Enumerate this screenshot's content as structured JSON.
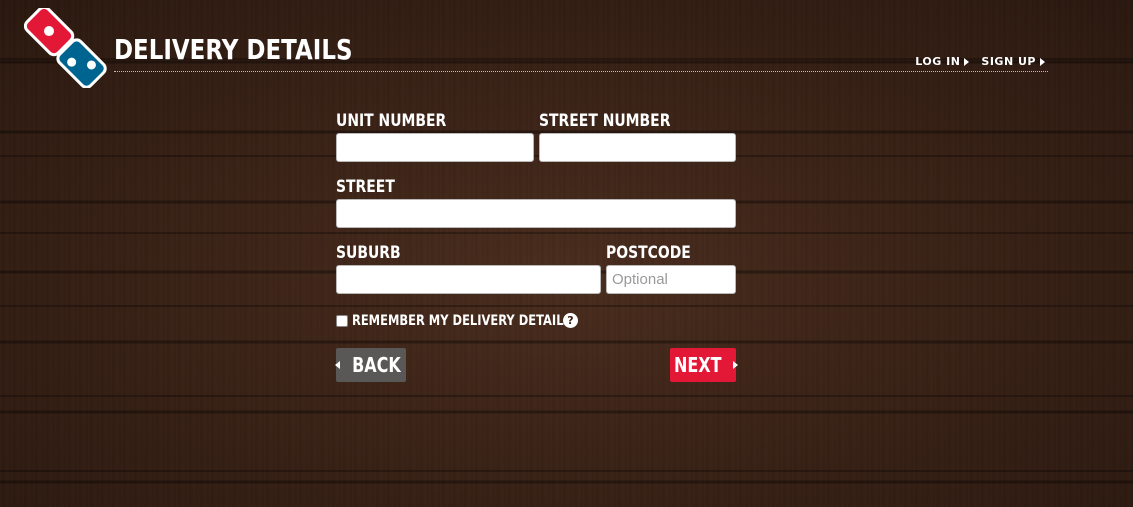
{
  "header": {
    "title": "DELIVERY DETAILS",
    "login_label": "LOG IN",
    "signup_label": "SIGN UP",
    "logo_icon": "dominos-logo-icon"
  },
  "form": {
    "unit_number": {
      "label": "UNIT NUMBER",
      "value": "",
      "placeholder": ""
    },
    "street_number": {
      "label": "STREET NUMBER",
      "value": "",
      "placeholder": ""
    },
    "street": {
      "label": "STREET",
      "value": "",
      "placeholder": ""
    },
    "suburb": {
      "label": "SUBURB",
      "value": "",
      "placeholder": ""
    },
    "postcode": {
      "label": "POSTCODE",
      "value": "",
      "placeholder": "Optional"
    },
    "remember_label": "REMEMBER MY DELIVERY DETAILS",
    "remember_checked": false,
    "help_glyph": "?"
  },
  "actions": {
    "back_label": "BACK",
    "next_label": "NEXT"
  },
  "colors": {
    "brand_red": "#e31837",
    "brand_blue": "#006491",
    "back_gray": "#5a5856"
  }
}
